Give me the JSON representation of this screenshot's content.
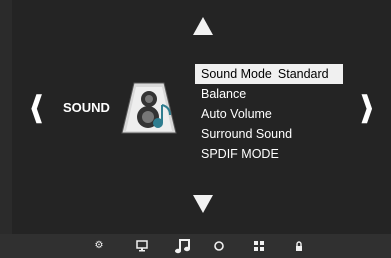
{
  "nav": {
    "up_arrow": "up-triangle",
    "down_arrow": "down-triangle",
    "left_chevron": "❰",
    "right_chevron": "❱"
  },
  "section": {
    "label": "SOUND",
    "icon": "speaker-note-icon"
  },
  "menu": {
    "items": [
      {
        "label": "Sound Mode",
        "value": "Standard",
        "selected": true
      },
      {
        "label": "Balance"
      },
      {
        "label": "Auto Volume"
      },
      {
        "label": "Surround Sound"
      },
      {
        "label": "SPDIF MODE"
      }
    ]
  },
  "bottom_bar": {
    "icons": [
      "gear-icon",
      "monitor-icon",
      "music-note-icon",
      "clock-icon",
      "grid-icon",
      "lock-icon"
    ],
    "active": "music-note-icon"
  },
  "colors": {
    "background": "#242424",
    "highlight": "#f0f0f0",
    "text": "#ffffff"
  }
}
